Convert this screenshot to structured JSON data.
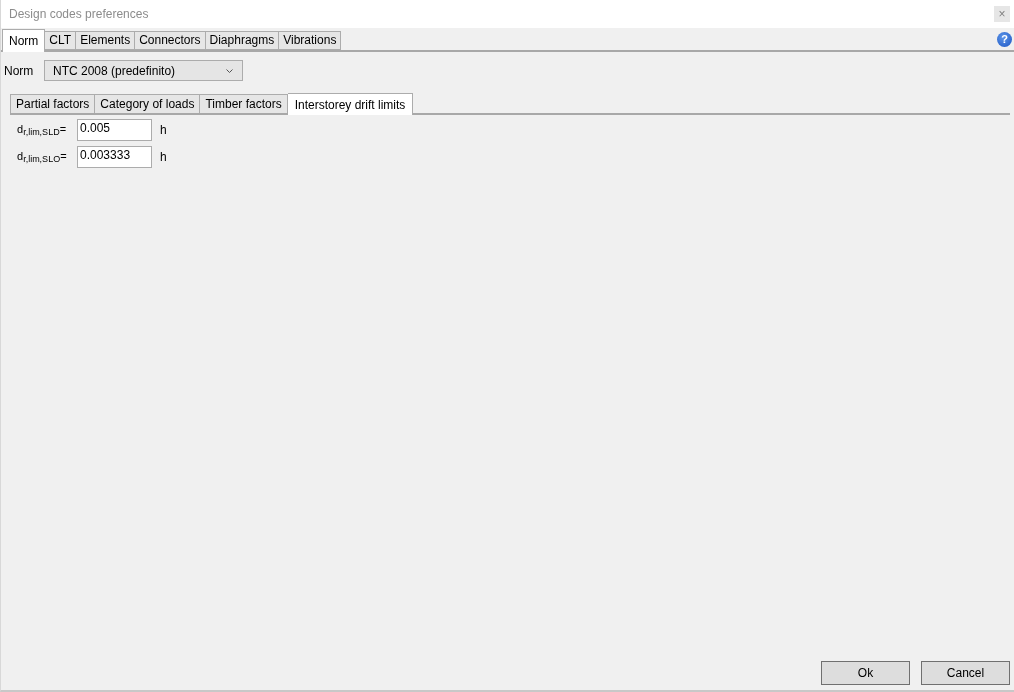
{
  "window": {
    "title": "Design codes preferences",
    "close_glyph": "×"
  },
  "tabs": [
    {
      "label": "Norm",
      "selected": true
    },
    {
      "label": "CLT",
      "selected": false
    },
    {
      "label": "Elements",
      "selected": false
    },
    {
      "label": "Connectors",
      "selected": false
    },
    {
      "label": "Diaphragms",
      "selected": false
    },
    {
      "label": "Vibrations",
      "selected": false
    }
  ],
  "help": {
    "glyph": "?"
  },
  "norm": {
    "label": "Norm",
    "value": "NTC 2008 (predefinito)"
  },
  "subtabs": [
    {
      "label": "Partial factors",
      "selected": false
    },
    {
      "label": "Category of loads",
      "selected": false
    },
    {
      "label": "Timber factors",
      "selected": false
    },
    {
      "label": "Interstorey drift limits",
      "selected": true
    }
  ],
  "fields": [
    {
      "label": "d$_{r,lim,SLD}$=",
      "value": "0.005",
      "unit": "h"
    },
    {
      "label": "d$_{r,lim,SLO}$=",
      "value": "0.003333",
      "unit": "h"
    }
  ],
  "buttons": [
    "Ok",
    "Cancel"
  ]
}
